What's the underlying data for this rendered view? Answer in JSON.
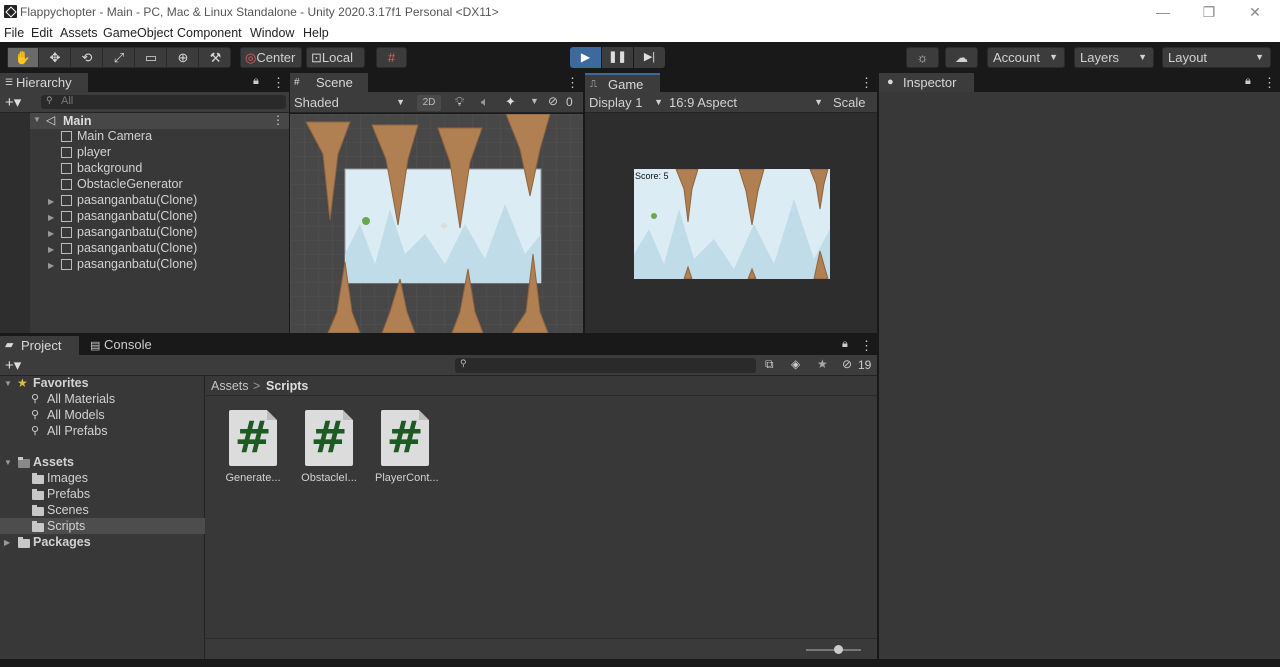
{
  "window": {
    "title": "Flappychopter - Main - PC, Mac & Linux Standalone - Unity 2020.3.17f1 Personal <DX11>",
    "minimize": "—",
    "restore": "❐",
    "close": "✕"
  },
  "menu": [
    "File",
    "Edit",
    "Assets",
    "GameObject",
    "Component",
    "Window",
    "Help"
  ],
  "toolbar": {
    "center": "Center",
    "local": "Local",
    "account": "Account",
    "layers": "Layers",
    "layout": "Layout"
  },
  "hierarchy": {
    "tab": "Hierarchy",
    "search_placeholder": "All",
    "scene": "Main",
    "items": [
      "Main Camera",
      "player",
      "background",
      "ObstacleGenerator",
      "pasanganbatu(Clone)",
      "pasanganbatu(Clone)",
      "pasanganbatu(Clone)",
      "pasanganbatu(Clone)",
      "pasanganbatu(Clone)"
    ]
  },
  "scene": {
    "tab": "Scene",
    "shading": "Shaded",
    "mode2d": "2D",
    "hidden_count": "0"
  },
  "game": {
    "tab": "Game",
    "display": "Display 1",
    "aspect": "16:9 Aspect",
    "scale": "Scale",
    "score": "Score: 5"
  },
  "inspector": {
    "tab": "Inspector"
  },
  "project": {
    "tab": "Project",
    "console_tab": "Console",
    "hidden_count": "19",
    "favorites": {
      "label": "Favorites",
      "items": [
        "All Materials",
        "All Models",
        "All Prefabs"
      ]
    },
    "assets": {
      "label": "Assets",
      "items": [
        "Images",
        "Prefabs",
        "Scenes",
        "Scripts"
      ]
    },
    "packages": "Packages",
    "breadcrumb": {
      "root": "Assets",
      "sep": ">",
      "current": "Scripts"
    },
    "files": [
      {
        "label": "Generate...",
        "icon": "#"
      },
      {
        "label": "ObstacleI...",
        "icon": "#"
      },
      {
        "label": "PlayerCont...",
        "icon": "#"
      }
    ]
  },
  "colors": {
    "accent": "#3d6a9e",
    "selection": "#46607c",
    "sky": "#dcecf5",
    "rock": "#b07f52"
  }
}
